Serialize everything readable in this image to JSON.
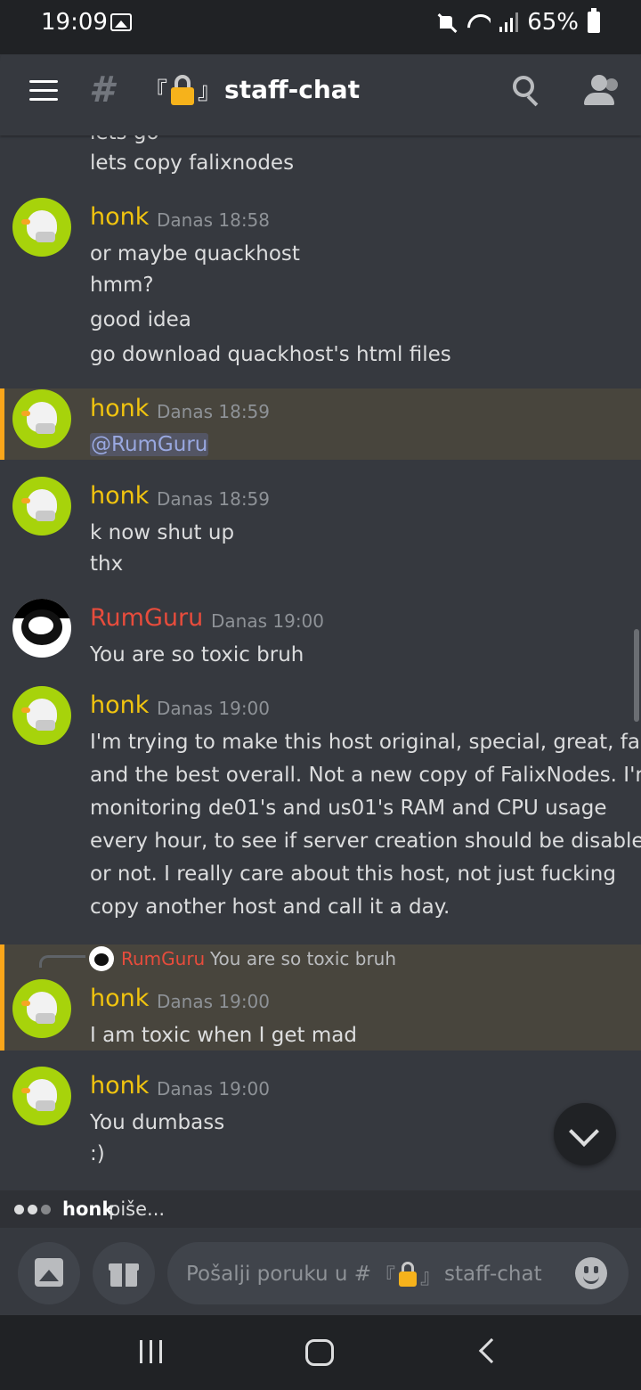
{
  "status_bar": {
    "time": "19:09",
    "battery": "65%"
  },
  "header": {
    "channel_name": "staff-chat",
    "bracket_open": "『",
    "bracket_close": "』"
  },
  "messages": {
    "partial_top": "lets go",
    "m0_line1": "lets copy falixnodes",
    "m1": {
      "author": "honk",
      "time": "Danas 18:58",
      "lines": [
        "or maybe quackhost",
        "hmm?",
        "good idea",
        "go download quackhost's html files"
      ]
    },
    "m2": {
      "author": "honk",
      "time": "Danas 18:59",
      "mention": "@RumGuru"
    },
    "m3": {
      "author": "honk",
      "time": "Danas 18:59",
      "lines": [
        "k now shut up",
        "thx"
      ]
    },
    "m4": {
      "author": "RumGuru",
      "time": "Danas 19:00",
      "lines": [
        "You are so toxic bruh"
      ]
    },
    "m5": {
      "author": "honk",
      "time": "Danas 19:00",
      "lines": [
        "I'm trying to make this host original, special, great, fast",
        "and the best overall. Not a new copy of FalixNodes. I'm",
        "monitoring de01's and us01's RAM and CPU usage",
        "every hour, to see if server creation should be disabled",
        "or not. I really care about this host, not just fucking",
        "copy another host and call it a day."
      ]
    },
    "m6": {
      "reply_author": "RumGuru",
      "reply_text": "You are so toxic bruh",
      "author": "honk",
      "time": "Danas 19:00",
      "lines": [
        "I am toxic when I get mad"
      ]
    },
    "m7": {
      "author": "honk",
      "time": "Danas 19:00",
      "lines": [
        "You dumbass",
        ":)"
      ]
    }
  },
  "typing": {
    "user": "honk",
    "text": "piše..."
  },
  "composer": {
    "placeholder_prefix": "Pošalji poruku u #",
    "placeholder_channel": "staff-chat"
  },
  "colors": {
    "background": "#36393f",
    "honk_name": "#f1c40f",
    "rumguru_name": "#e74c3c",
    "highlight_bar": "#faa61a",
    "mention": "#99a8e0"
  }
}
